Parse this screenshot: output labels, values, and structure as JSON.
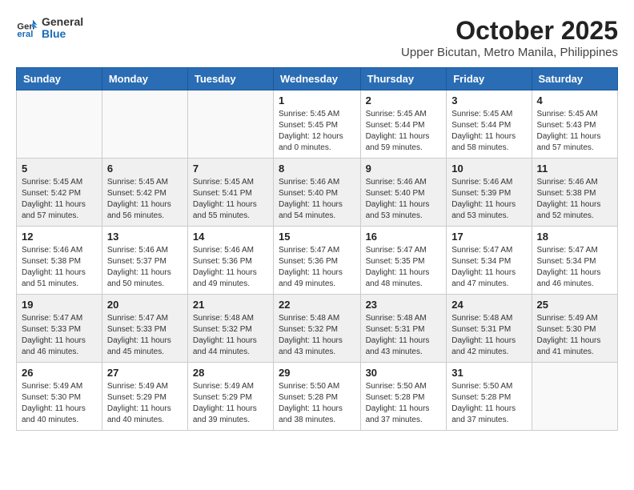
{
  "header": {
    "logo_line1": "General",
    "logo_line2": "Blue",
    "month": "October 2025",
    "location": "Upper Bicutan, Metro Manila, Philippines"
  },
  "weekdays": [
    "Sunday",
    "Monday",
    "Tuesday",
    "Wednesday",
    "Thursday",
    "Friday",
    "Saturday"
  ],
  "weeks": [
    [
      {
        "day": "",
        "info": ""
      },
      {
        "day": "",
        "info": ""
      },
      {
        "day": "",
        "info": ""
      },
      {
        "day": "1",
        "info": "Sunrise: 5:45 AM\nSunset: 5:45 PM\nDaylight: 12 hours\nand 0 minutes."
      },
      {
        "day": "2",
        "info": "Sunrise: 5:45 AM\nSunset: 5:44 PM\nDaylight: 11 hours\nand 59 minutes."
      },
      {
        "day": "3",
        "info": "Sunrise: 5:45 AM\nSunset: 5:44 PM\nDaylight: 11 hours\nand 58 minutes."
      },
      {
        "day": "4",
        "info": "Sunrise: 5:45 AM\nSunset: 5:43 PM\nDaylight: 11 hours\nand 57 minutes."
      }
    ],
    [
      {
        "day": "5",
        "info": "Sunrise: 5:45 AM\nSunset: 5:42 PM\nDaylight: 11 hours\nand 57 minutes."
      },
      {
        "day": "6",
        "info": "Sunrise: 5:45 AM\nSunset: 5:42 PM\nDaylight: 11 hours\nand 56 minutes."
      },
      {
        "day": "7",
        "info": "Sunrise: 5:45 AM\nSunset: 5:41 PM\nDaylight: 11 hours\nand 55 minutes."
      },
      {
        "day": "8",
        "info": "Sunrise: 5:46 AM\nSunset: 5:40 PM\nDaylight: 11 hours\nand 54 minutes."
      },
      {
        "day": "9",
        "info": "Sunrise: 5:46 AM\nSunset: 5:40 PM\nDaylight: 11 hours\nand 53 minutes."
      },
      {
        "day": "10",
        "info": "Sunrise: 5:46 AM\nSunset: 5:39 PM\nDaylight: 11 hours\nand 53 minutes."
      },
      {
        "day": "11",
        "info": "Sunrise: 5:46 AM\nSunset: 5:38 PM\nDaylight: 11 hours\nand 52 minutes."
      }
    ],
    [
      {
        "day": "12",
        "info": "Sunrise: 5:46 AM\nSunset: 5:38 PM\nDaylight: 11 hours\nand 51 minutes."
      },
      {
        "day": "13",
        "info": "Sunrise: 5:46 AM\nSunset: 5:37 PM\nDaylight: 11 hours\nand 50 minutes."
      },
      {
        "day": "14",
        "info": "Sunrise: 5:46 AM\nSunset: 5:36 PM\nDaylight: 11 hours\nand 49 minutes."
      },
      {
        "day": "15",
        "info": "Sunrise: 5:47 AM\nSunset: 5:36 PM\nDaylight: 11 hours\nand 49 minutes."
      },
      {
        "day": "16",
        "info": "Sunrise: 5:47 AM\nSunset: 5:35 PM\nDaylight: 11 hours\nand 48 minutes."
      },
      {
        "day": "17",
        "info": "Sunrise: 5:47 AM\nSunset: 5:34 PM\nDaylight: 11 hours\nand 47 minutes."
      },
      {
        "day": "18",
        "info": "Sunrise: 5:47 AM\nSunset: 5:34 PM\nDaylight: 11 hours\nand 46 minutes."
      }
    ],
    [
      {
        "day": "19",
        "info": "Sunrise: 5:47 AM\nSunset: 5:33 PM\nDaylight: 11 hours\nand 46 minutes."
      },
      {
        "day": "20",
        "info": "Sunrise: 5:47 AM\nSunset: 5:33 PM\nDaylight: 11 hours\nand 45 minutes."
      },
      {
        "day": "21",
        "info": "Sunrise: 5:48 AM\nSunset: 5:32 PM\nDaylight: 11 hours\nand 44 minutes."
      },
      {
        "day": "22",
        "info": "Sunrise: 5:48 AM\nSunset: 5:32 PM\nDaylight: 11 hours\nand 43 minutes."
      },
      {
        "day": "23",
        "info": "Sunrise: 5:48 AM\nSunset: 5:31 PM\nDaylight: 11 hours\nand 43 minutes."
      },
      {
        "day": "24",
        "info": "Sunrise: 5:48 AM\nSunset: 5:31 PM\nDaylight: 11 hours\nand 42 minutes."
      },
      {
        "day": "25",
        "info": "Sunrise: 5:49 AM\nSunset: 5:30 PM\nDaylight: 11 hours\nand 41 minutes."
      }
    ],
    [
      {
        "day": "26",
        "info": "Sunrise: 5:49 AM\nSunset: 5:30 PM\nDaylight: 11 hours\nand 40 minutes."
      },
      {
        "day": "27",
        "info": "Sunrise: 5:49 AM\nSunset: 5:29 PM\nDaylight: 11 hours\nand 40 minutes."
      },
      {
        "day": "28",
        "info": "Sunrise: 5:49 AM\nSunset: 5:29 PM\nDaylight: 11 hours\nand 39 minutes."
      },
      {
        "day": "29",
        "info": "Sunrise: 5:50 AM\nSunset: 5:28 PM\nDaylight: 11 hours\nand 38 minutes."
      },
      {
        "day": "30",
        "info": "Sunrise: 5:50 AM\nSunset: 5:28 PM\nDaylight: 11 hours\nand 37 minutes."
      },
      {
        "day": "31",
        "info": "Sunrise: 5:50 AM\nSunset: 5:28 PM\nDaylight: 11 hours\nand 37 minutes."
      },
      {
        "day": "",
        "info": ""
      }
    ]
  ]
}
